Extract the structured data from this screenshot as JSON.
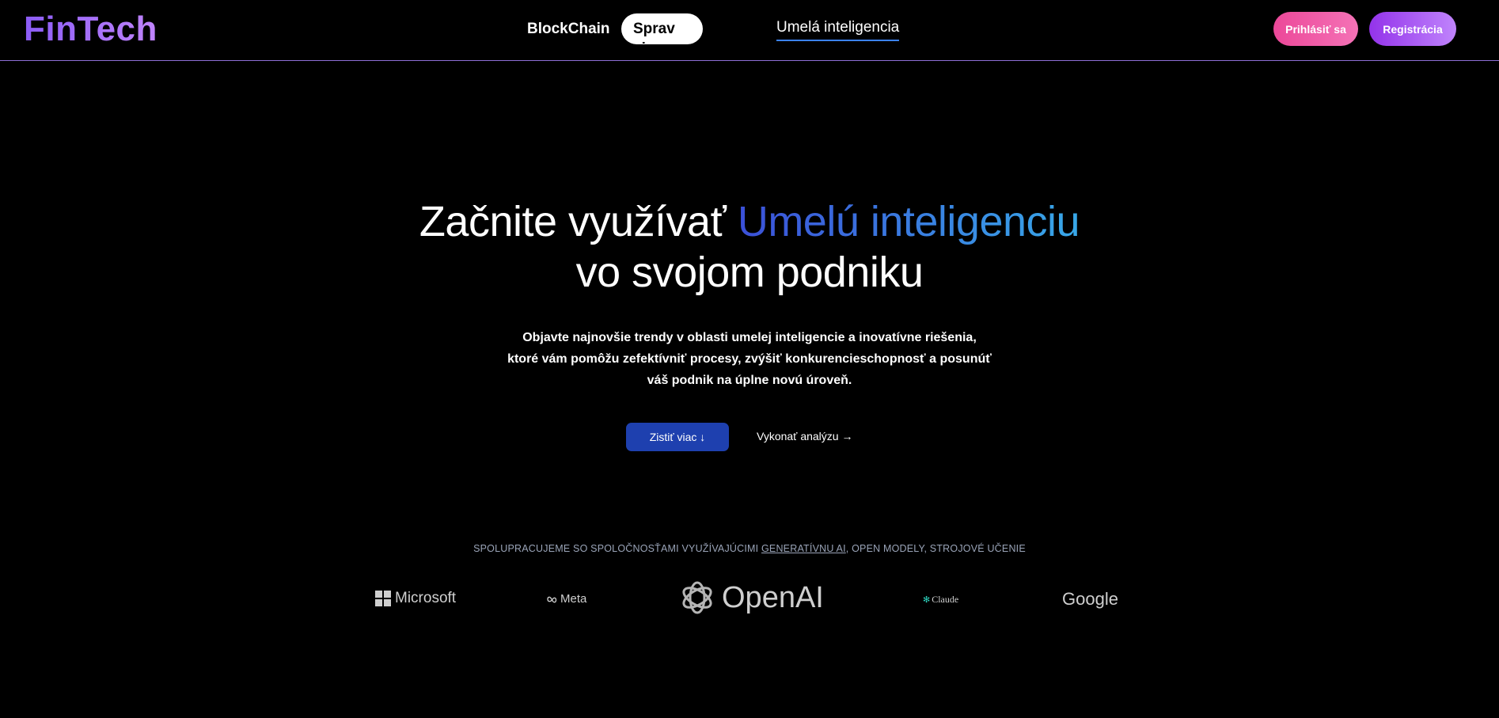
{
  "header": {
    "logo": "FinTech",
    "nav": {
      "blockchain": "BlockChain",
      "analysis": "Sprav si Analyzu",
      "ai": "Umelá inteligencia"
    },
    "login": "Prihlásiť sa",
    "register": "Registrácia"
  },
  "hero": {
    "title_prefix": "Začnite využívať ",
    "title_highlight": "Umelú inteligenciu",
    "title_line2": "vo svojom podniku",
    "subtitle": "Objavte najnovšie trendy v oblasti umelej inteligencie a inovatívne riešenia, ktoré vám pomôžu zefektívniť procesy, zvýšiť konkurencieschopnosť a posunúť váš podnik na úplne novú úroveň.",
    "cta_primary": "Zistiť viac ↓",
    "cta_secondary": "Vykonať analýzu →"
  },
  "partners": {
    "caption_start": "SPOLUPRACUJEME SO SPOLOČNOSŤAMI VYUŽÍVAJÚCIMI ",
    "caption_link": "GENERATÍVNU AI",
    "caption_end": ", OPEN MODELY, STROJOVÉ UČENIE",
    "logos": {
      "microsoft": "Microsoft",
      "meta": "Meta",
      "openai": "OpenAI",
      "claude": "Claude",
      "google": "Google"
    }
  },
  "colors": {
    "background": "#000000",
    "accent_purple": "#8b5cf6",
    "accent_pink": "#ec4899",
    "cta_blue": "#1e40af",
    "gradient_blue_start": "#3b50d8",
    "gradient_blue_end": "#38a8e8"
  }
}
